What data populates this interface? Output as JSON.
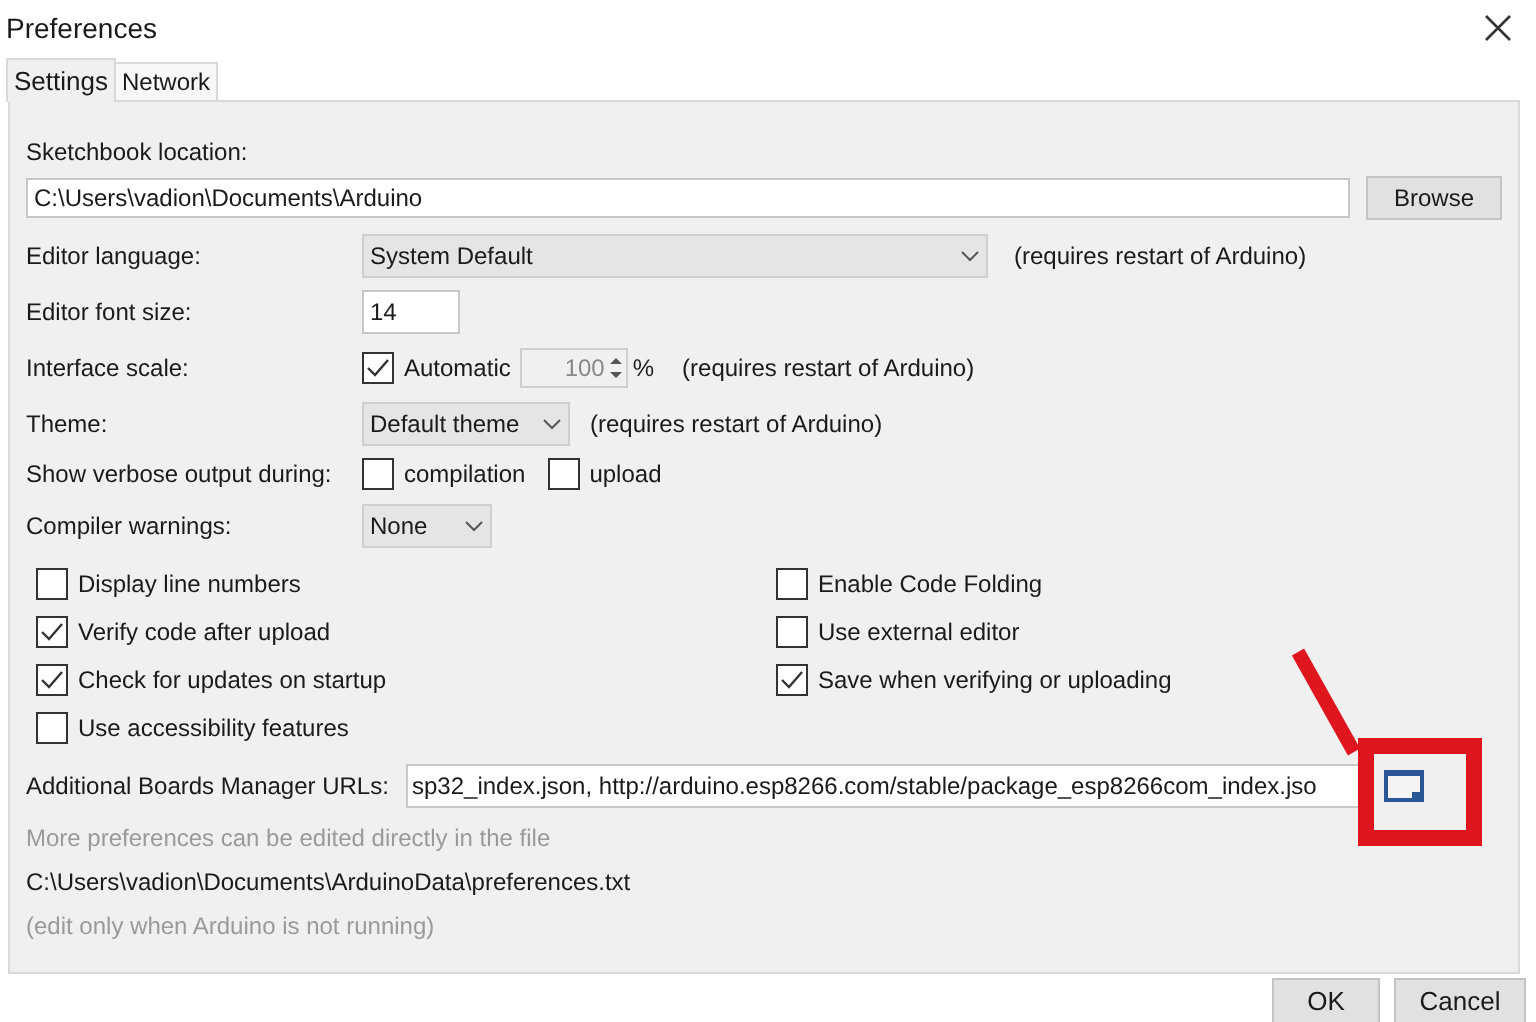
{
  "window": {
    "title": "Preferences"
  },
  "tabs": [
    {
      "label": "Settings",
      "selected": true
    },
    {
      "label": "Network",
      "selected": false
    }
  ],
  "sketchbook_location": {
    "label": "Sketchbook location:",
    "value": "C:\\Users\\vadion\\Documents\\Arduino",
    "button": "Browse"
  },
  "editor_language": {
    "label": "Editor language:",
    "value": "System Default",
    "note": "(requires restart of Arduino)"
  },
  "editor_font_size": {
    "label": "Editor font size:",
    "value": "14"
  },
  "interface_scale": {
    "label": "Interface scale:",
    "automatic": {
      "label": "Automatic",
      "checked": true
    },
    "value": "100",
    "unit": "%",
    "note": "(requires restart of Arduino)"
  },
  "theme": {
    "label": "Theme:",
    "value": "Default theme",
    "note": "(requires restart of Arduino)"
  },
  "verbose_output": {
    "label": "Show verbose output during:",
    "options": [
      {
        "label": "compilation",
        "checked": false
      },
      {
        "label": "upload",
        "checked": false
      }
    ]
  },
  "compiler_warnings": {
    "label": "Compiler warnings:",
    "value": "None"
  },
  "options_left": [
    {
      "label": "Display line numbers",
      "checked": false
    },
    {
      "label": "Verify code after upload",
      "checked": true
    },
    {
      "label": "Check for updates on startup",
      "checked": true
    },
    {
      "label": "Use accessibility features",
      "checked": false
    }
  ],
  "options_right": [
    {
      "label": "Enable Code Folding",
      "checked": false
    },
    {
      "label": "Use external editor",
      "checked": false
    },
    {
      "label": "Save when verifying or uploading",
      "checked": true
    }
  ],
  "boards_manager_urls": {
    "label": "Additional Boards Manager URLs:",
    "value": "sp32_index.json, http://arduino.esp8266.com/stable/package_esp8266com_index.jso"
  },
  "more_preferences": "More preferences can be edited directly in the file",
  "preferences_path": "C:\\Users\\vadion\\Documents\\ArduinoData\\preferences.txt",
  "edit_note": "(edit only when Arduino is not running)",
  "buttons": [
    "OK",
    "Cancel"
  ]
}
